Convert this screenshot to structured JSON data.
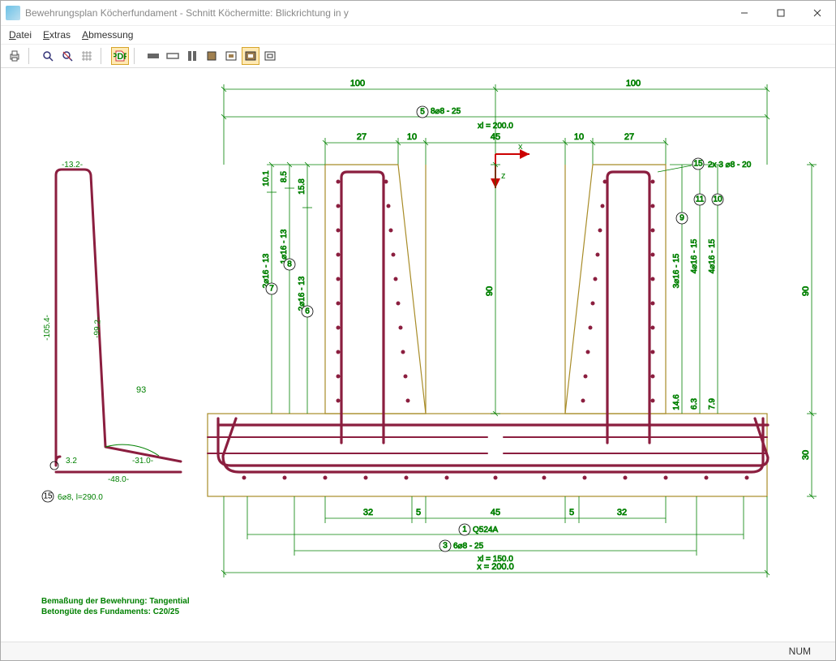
{
  "window": {
    "title": "Bewehrungsplan Köcherfundament - Schnitt Köchermitte: Blickrichtung in y"
  },
  "menu": {
    "datei": "Datei",
    "extras": "Extras",
    "abmessung": "Abmessung"
  },
  "statusbar": {
    "num": "NUM"
  },
  "dims": {
    "top100_left": "100",
    "top100_right": "100",
    "ref5": "5",
    "top_spec5": "8⌀8 - 25",
    "top_xl": "xl = 200.0",
    "d27l": "27",
    "d10l": "10",
    "d45": "45",
    "d10r": "10",
    "d27r": "27",
    "axis_x": "x",
    "axis_z": "z",
    "ref15_right": "15",
    "right_spec15": "2x 3 ⌀8 - 20",
    "ref11": "11",
    "ref10": "10",
    "ref9": "9",
    "spec9": "3⌀16 - 15",
    "spec10": "4⌀16 - 15",
    "spec11": "4⌀16 - 15",
    "right_90": "90",
    "center_90": "90",
    "d146": "14.6",
    "d63": "6.3",
    "d79": "7.9",
    "right_30": "30",
    "left_101": "10.1",
    "left_85": "8.5",
    "left_158": "15.8",
    "ref8": "8",
    "spec8": "1⌀16 - 13",
    "ref7": "7",
    "spec7": "2⌀16 - 13",
    "ref6": "6",
    "spec6": "2⌀16 - 13",
    "bar13_2": "-13.2-",
    "bar99_2": "-99.2-",
    "bar105_4": "-105.4-",
    "bar93": "93",
    "bar3_2": "3.2",
    "bar31": "-31.0-",
    "bar48": "-48.0-",
    "ref15_left": "15",
    "leftspec": "6⌀8, l=290.0",
    "b32l": "32",
    "b5l": "5",
    "b45": "45",
    "b5r": "5",
    "b32r": "32",
    "ref1": "1",
    "spec1": "Q524A",
    "ref3": "3",
    "spec3": "6⌀8 - 25",
    "bottom_xl150": "xl = 150.0",
    "bottom_x200": "x = 200.0",
    "note1": "Bemaßung der Bewehrung: Tangential",
    "note2": "Betongüte des Fundaments: C20/25"
  },
  "chart_data": {
    "type": "diagram",
    "title": "Bewehrungsplan Köcherfundament – Schnitt Köchermitte, Blickrichtung y",
    "units": "cm",
    "foundation": {
      "width_x": 200.0,
      "height": 30,
      "socket_depth": 90
    },
    "socket_inner_width": 45,
    "wall_top_segments_cm": [
      27,
      10,
      45,
      10,
      27
    ],
    "rebar_positions": [
      {
        "id": 1,
        "spec": "Q524A"
      },
      {
        "id": 3,
        "spec": "6⌀8 - 25",
        "xl": 150.0
      },
      {
        "id": 5,
        "spec": "8⌀8 - 25",
        "xl": 200.0
      },
      {
        "id": 6,
        "spec": "2⌀16 - 13"
      },
      {
        "id": 7,
        "spec": "2⌀16 - 13"
      },
      {
        "id": 8,
        "spec": "1⌀16 - 13"
      },
      {
        "id": 9,
        "spec": "3⌀16 - 15"
      },
      {
        "id": 10,
        "spec": "4⌀16 - 15"
      },
      {
        "id": 11,
        "spec": "4⌀16 - 15"
      },
      {
        "id": 15,
        "spec_right": "2x 3 ⌀8 - 20",
        "spec_left": "6⌀8, l=290.0"
      }
    ],
    "stirrup_detail": {
      "id": 15,
      "segments_cm": {
        "top": 13.2,
        "outer_vertical": 105.4,
        "inner_vertical": 99.2,
        "bottom_inner": 31.0,
        "bottom_outer": 48.0,
        "hook": 3.2
      },
      "bend_angle_deg": 93,
      "total_length_cm": 290.0
    },
    "vertical_stirrup_offsets_right_cm": [
      14.6,
      6.3,
      7.9
    ],
    "vertical_stirrup_offsets_left_cm": [
      10.1,
      8.5,
      15.8
    ],
    "half_widths_top_cm": [
      100,
      100
    ],
    "bottom_bar_spans_cm": [
      32,
      5,
      45,
      5,
      32
    ],
    "concrete_grade": "C20/25",
    "dimension_mode": "Tangential"
  }
}
